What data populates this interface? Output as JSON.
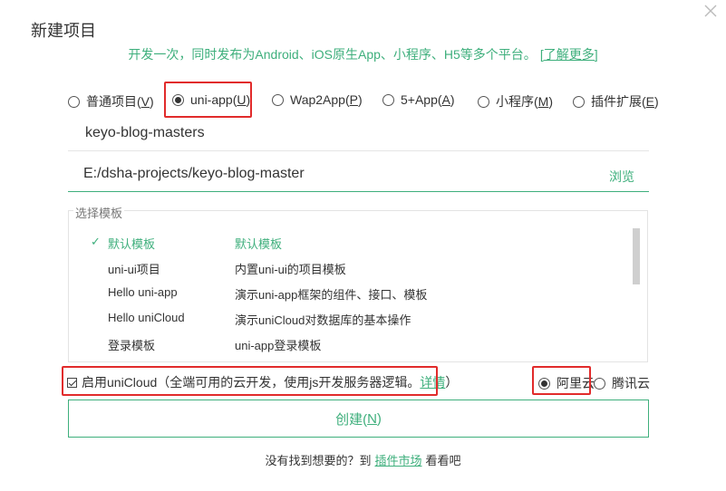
{
  "dialog": {
    "title": "新建项目",
    "subtitle": "开发一次，同时发布为Android、iOS原生App、小程序、H5等多个平台。",
    "learn_more": "[了解更多]"
  },
  "project_types": [
    {
      "label": "普通项目(",
      "key": "V",
      "checked": false
    },
    {
      "label": "uni-app(",
      "key": "U",
      "checked": true
    },
    {
      "label": "Wap2App(",
      "key": "P",
      "checked": false
    },
    {
      "label": "5+App(",
      "key": "A",
      "checked": false
    },
    {
      "label": "小程序(",
      "key": "M",
      "checked": false
    },
    {
      "label": "插件扩展(",
      "key": "E",
      "checked": false
    }
  ],
  "project_name": "keyo-blog-masters",
  "project_path": "E:/dsha-projects/keyo-blog-master",
  "browse_label": "浏览",
  "templates": {
    "legend": "选择模板",
    "items": [
      {
        "check": "✓",
        "name": "默认模板",
        "desc": "默认模板",
        "selected": true
      },
      {
        "check": "",
        "name": "uni-ui项目",
        "desc": "内置uni-ui的项目模板",
        "selected": false
      },
      {
        "check": "",
        "name": "Hello uni-app",
        "desc": "演示uni-app框架的组件、接口、模板",
        "selected": false
      },
      {
        "check": "",
        "name": "Hello uniCloud",
        "desc": "演示uniCloud对数据库的基本操作",
        "selected": false
      },
      {
        "check": "",
        "name": "登录模板",
        "desc": "uni-app登录模板",
        "selected": false
      }
    ]
  },
  "unicloud": {
    "label": "启用uniCloud（全端可用的云开发，使用js开发服务器逻辑。",
    "link": "详情",
    "close_paren": "）",
    "checked": true
  },
  "providers": [
    {
      "label": "阿里云",
      "checked": true
    },
    {
      "label": "腾讯云",
      "checked": false
    }
  ],
  "create_button": {
    "label": "创建(",
    "key": "N",
    "suffix": ")"
  },
  "footer": {
    "before": "没有找到想要的？到",
    "link": "插件市场",
    "after": "看看吧"
  },
  "colors": {
    "accent": "#3eaf7c",
    "highlight": "#e12b2b"
  }
}
